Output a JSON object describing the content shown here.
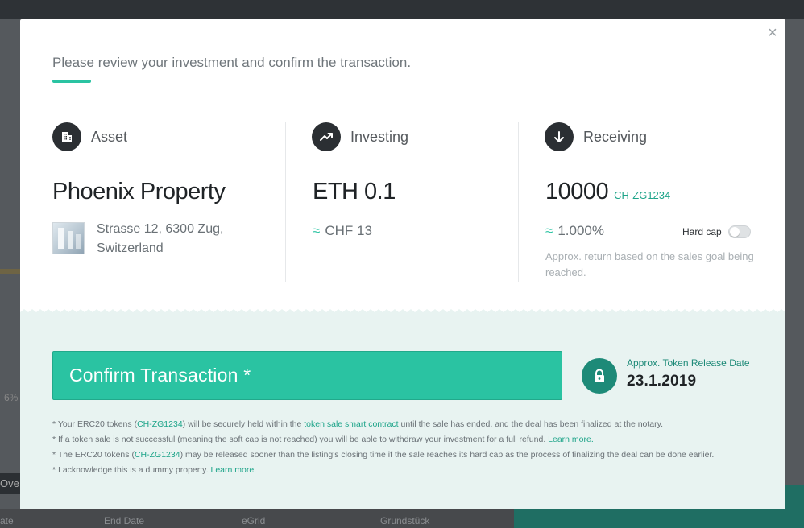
{
  "background": {
    "left_tab": "Ove",
    "left_text": "6%",
    "bottom_items": [
      "ate",
      "End Date",
      "eGrid",
      "Grundstück"
    ]
  },
  "modal": {
    "intro": "Please review your investment and confirm the transaction.",
    "close_symbol": "×"
  },
  "asset": {
    "title": "Asset",
    "name": "Phoenix Property",
    "address": "Strasse 12, 6300 Zug, Switzerland"
  },
  "investing": {
    "title": "Investing",
    "amount": "ETH 0.1",
    "approx_symbol": "≈",
    "approx_value": "CHF 13"
  },
  "receiving": {
    "title": "Receiving",
    "amount": "10000",
    "token": "CH-ZG1234",
    "approx_symbol": "≈",
    "approx_value": "1.000%",
    "hardcap_label": "Hard cap",
    "hardcap_on": false,
    "note": "Approx. return based on the sales goal being reached."
  },
  "confirm": {
    "button_label": "Confirm Transaction *",
    "release_label": "Approx. Token Release Date",
    "release_date": "23.1.2019"
  },
  "notes": {
    "n1_a": "* Your ERC20 tokens (",
    "n1_token": "CH-ZG1234",
    "n1_b": ") will be securely held within the ",
    "n1_link": "token sale smart contract",
    "n1_c": " until the sale has ended, and the deal has been finalized at the notary.",
    "n2_a": "* If a token sale is not successful (meaning the soft cap is not reached) you will be able to withdraw your investment for a full refund. ",
    "n2_link": "Learn more.",
    "n3_a": "* The ERC20 tokens (",
    "n3_token": "CH-ZG1234",
    "n3_b": ") may be released sooner than the listing's closing time if the sale reaches its hard cap as the process of finalizing the deal can be done earlier.",
    "n4_a": "* I acknowledge this is a dummy property. ",
    "n4_link": "Learn more."
  },
  "colors": {
    "accent": "#2ac3a2",
    "accent_dark": "#1d8a78",
    "lower_bg": "#e8f3f1",
    "icon_bg": "#2b2f33"
  }
}
